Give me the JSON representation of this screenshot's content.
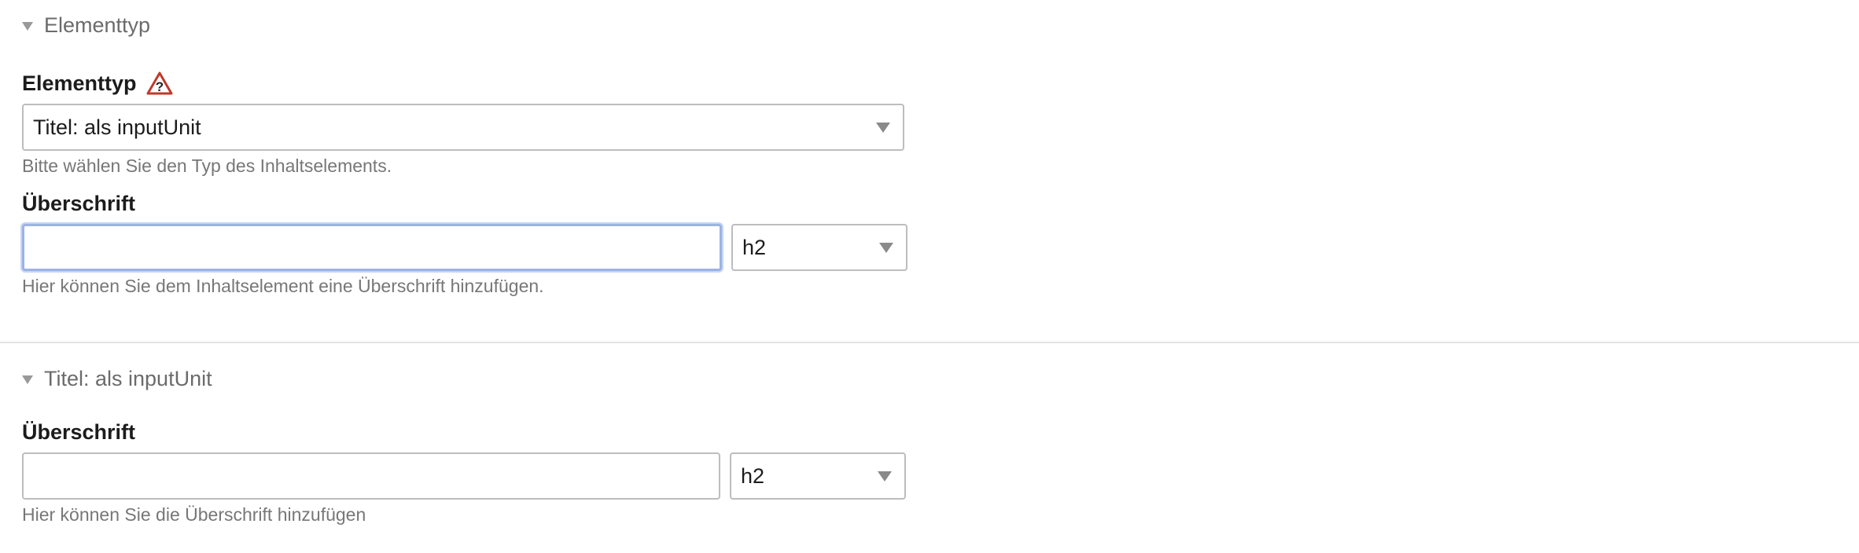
{
  "section1": {
    "legend": "Elementtyp",
    "elementtyp": {
      "label": "Elementtyp",
      "selected": "Titel: als inputUnit",
      "help": "Bitte wählen Sie den Typ des Inhaltselements."
    },
    "heading": {
      "label": "Überschrift",
      "value": "",
      "level": "h2",
      "help": "Hier können Sie dem Inhaltselement eine Überschrift hinzufügen."
    }
  },
  "section2": {
    "legend": "Titel: als inputUnit",
    "heading": {
      "label": "Überschrift",
      "value": "",
      "level": "h2",
      "help": "Hier können Sie die Überschrift hinzufügen"
    }
  },
  "icons": {
    "warning": "warning-triangle-question-icon",
    "collapse": "triangle-down-icon",
    "dropdown": "caret-down-icon"
  },
  "colors": {
    "focus_border": "#9bb3e6",
    "warning_red": "#c0392b"
  }
}
